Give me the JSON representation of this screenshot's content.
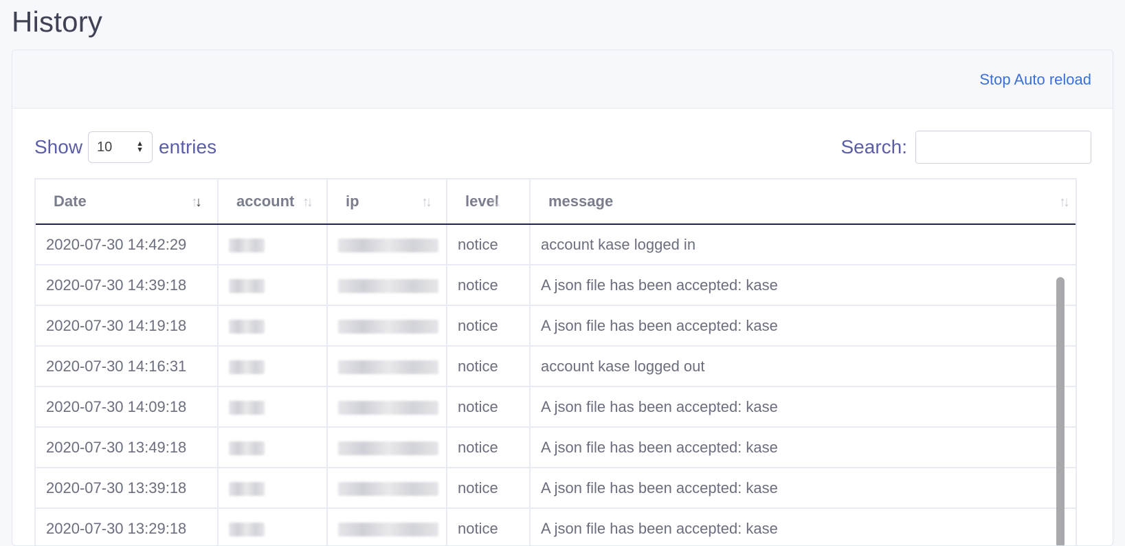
{
  "page_title": "History",
  "header": {
    "reload_link": "Stop Auto reload"
  },
  "controls": {
    "show_label": "Show",
    "length_value": "10",
    "entries_label": "entries",
    "search_label": "Search:",
    "search_value": ""
  },
  "columns": [
    "Date",
    "account",
    "ip",
    "level",
    "message"
  ],
  "rows": [
    {
      "date": "2020-07-30 14:42:29",
      "level": "notice",
      "message": "account kase logged in"
    },
    {
      "date": "2020-07-30 14:39:18",
      "level": "notice",
      "message": "A json file has been accepted: kase"
    },
    {
      "date": "2020-07-30 14:19:18",
      "level": "notice",
      "message": "A json file has been accepted: kase"
    },
    {
      "date": "2020-07-30 14:16:31",
      "level": "notice",
      "message": "account kase logged out"
    },
    {
      "date": "2020-07-30 14:09:18",
      "level": "notice",
      "message": "A json file has been accepted: kase"
    },
    {
      "date": "2020-07-30 13:49:18",
      "level": "notice",
      "message": "A json file has been accepted: kase"
    },
    {
      "date": "2020-07-30 13:39:18",
      "level": "notice",
      "message": "A json file has been accepted: kase"
    },
    {
      "date": "2020-07-30 13:29:18",
      "level": "notice",
      "message": "A json file has been accepted: kase"
    }
  ],
  "colors": {
    "link": "#3b6fd6",
    "label": "#5b5ea6",
    "header_underline": "#1f2150"
  }
}
